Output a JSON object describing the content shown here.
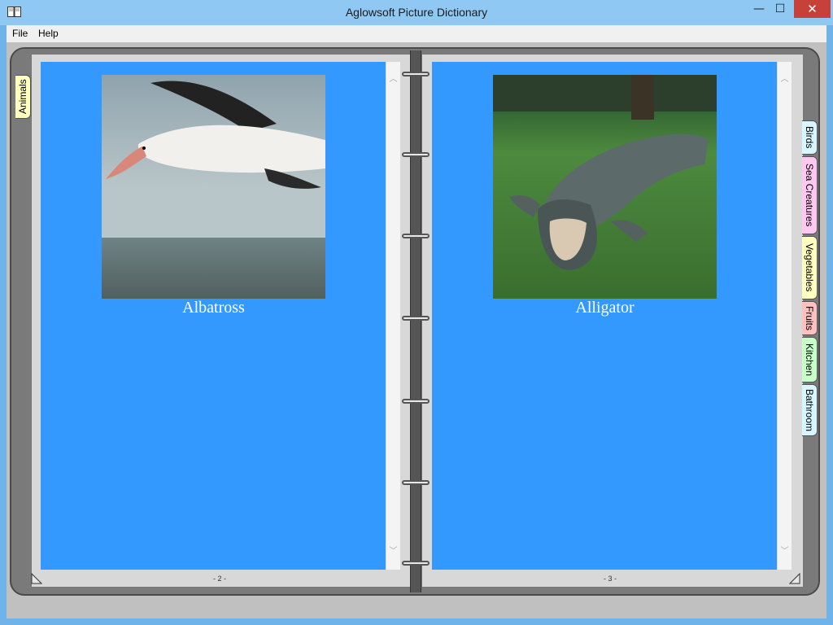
{
  "window": {
    "title": "Aglowsoft Picture Dictionary",
    "controls": {
      "minimize": "—",
      "maximize": "☐",
      "close": "✕"
    }
  },
  "menu": {
    "items": [
      "File",
      "Help"
    ]
  },
  "left_page": {
    "tab_label": "Animals",
    "caption": "Albatross",
    "page_number": "- 2 -",
    "picture_icon": "albatross-photo"
  },
  "right_page": {
    "caption": "Alligator",
    "page_number": "- 3 -",
    "picture_icon": "alligator-photo"
  },
  "category_tabs": [
    {
      "label": "Birds",
      "color": "#d8f6ff"
    },
    {
      "label": "Sea Creatures",
      "color": "#ffc8f0"
    },
    {
      "label": "Vegetables",
      "color": "#ffffc0"
    },
    {
      "label": "Fruits",
      "color": "#ffc0c0"
    },
    {
      "label": "Kitchen",
      "color": "#c8ffc8"
    },
    {
      "label": "Bathroom",
      "color": "#d8f6ff"
    }
  ],
  "colors": {
    "page_background": "#3399ff",
    "titlebar": "#8ec8f3",
    "close_button": "#c7413a"
  }
}
